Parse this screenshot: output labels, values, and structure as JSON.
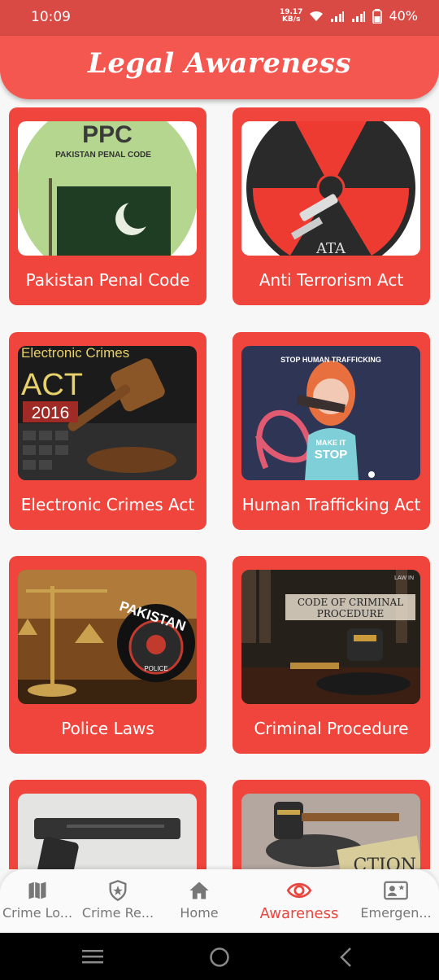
{
  "status_bar": {
    "time": "10:09",
    "speed_value": "19.17",
    "speed_unit": "KB/s",
    "battery": "40%"
  },
  "header": {
    "title": "Legal Awareness"
  },
  "cards": [
    {
      "label": "Pakistan Penal Code",
      "image_text": [
        "PPC",
        "PAKISTAN PENAL CODE"
      ]
    },
    {
      "label": "Anti Terrorism Act",
      "image_text": [
        "ATA"
      ]
    },
    {
      "label": "Electronic Crimes Act",
      "image_text": [
        "Electronic Crimes",
        "ACT",
        "2016"
      ]
    },
    {
      "label": "Human Trafficking Act",
      "image_text": [
        "STOP HUMAN TRAFFICKING",
        "MAKE IT",
        "STOP"
      ]
    },
    {
      "label": "Police Laws",
      "image_text": [
        "PAKISTAN",
        "POLICE"
      ]
    },
    {
      "label": "Criminal Procedure",
      "image_text": [
        "CODE OF CRIMINAL",
        "PROCEDURE",
        "LAW IN"
      ]
    },
    {
      "label": "",
      "image_text": []
    },
    {
      "label": "",
      "image_text": [
        "CTION"
      ]
    }
  ],
  "bottom_nav": [
    {
      "label": "Crime Lo...",
      "icon": "map-icon"
    },
    {
      "label": "Crime Re...",
      "icon": "police-badge-icon"
    },
    {
      "label": "Home",
      "icon": "home-icon"
    },
    {
      "label": "Awareness",
      "icon": "eye-icon",
      "active": true
    },
    {
      "label": "Emergen...",
      "icon": "contact-card-icon"
    }
  ],
  "colors": {
    "accent": "#f0453c",
    "header": "#f4574f",
    "status_bar": "#d94a45"
  }
}
